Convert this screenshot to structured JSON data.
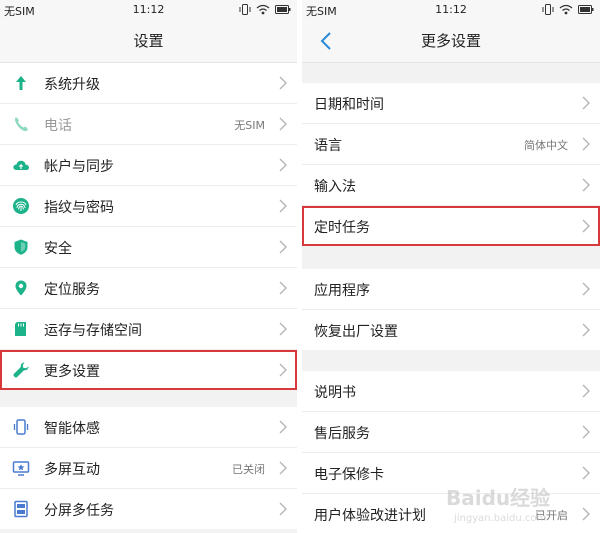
{
  "left": {
    "status": {
      "carrier": "无SIM",
      "time": "11:12"
    },
    "title": "设置",
    "group1": [
      {
        "label": "系统升级",
        "icon": "up-arrow-icon",
        "color": "#1db38a"
      },
      {
        "label": "电话",
        "value": "无SIM",
        "icon": "phone-icon",
        "color": "#8fd9c2",
        "disabled": true
      },
      {
        "label": "帐户与同步",
        "icon": "cloud-icon",
        "color": "#1db38a"
      },
      {
        "label": "指纹与密码",
        "icon": "fingerprint-icon",
        "color": "#1db38a"
      },
      {
        "label": "安全",
        "icon": "shield-icon",
        "color": "#1db38a"
      },
      {
        "label": "定位服务",
        "icon": "location-pin-icon",
        "color": "#1db38a"
      },
      {
        "label": "运存与存储空间",
        "icon": "sd-card-icon",
        "color": "#1db38a"
      },
      {
        "label": "更多设置",
        "icon": "wrench-icon",
        "color": "#1db38a",
        "highlighted": true
      }
    ],
    "group2": [
      {
        "label": "智能体感",
        "icon": "phone-vibrate-icon",
        "color": "#4a7bd1"
      },
      {
        "label": "多屏互动",
        "value": "已关闭",
        "icon": "screen-cast-icon",
        "color": "#4a7bd1"
      },
      {
        "label": "分屏多任务",
        "icon": "split-screen-icon",
        "color": "#4a7bd1"
      }
    ]
  },
  "right": {
    "status": {
      "carrier": "无SIM",
      "time": "11:12"
    },
    "title": "更多设置",
    "group1": [
      {
        "label": "日期和时间"
      },
      {
        "label": "语言",
        "value": "简体中文"
      },
      {
        "label": "输入法"
      },
      {
        "label": "定时任务",
        "highlighted": true
      }
    ],
    "group2": [
      {
        "label": "应用程序"
      },
      {
        "label": "恢复出厂设置"
      }
    ],
    "group3": [
      {
        "label": "说明书"
      },
      {
        "label": "售后服务"
      },
      {
        "label": "电子保修卡"
      },
      {
        "label": "用户体验改进计划",
        "value": "已开启"
      }
    ]
  },
  "watermark": {
    "brand": "Baidu经验",
    "url": "jingyan.baidu.com"
  },
  "colors": {
    "accent": "#1db38a",
    "highlight": "#d9383a",
    "back": "#2a8ad8"
  }
}
